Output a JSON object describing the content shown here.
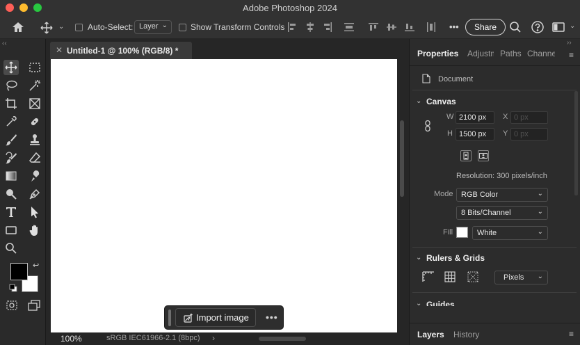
{
  "window": {
    "title": "Adobe Photoshop 2024"
  },
  "options_bar": {
    "auto_select_label": "Auto-Select:",
    "auto_select_value": "Layer",
    "show_transform_label": "Show Transform Controls",
    "more_label": "•••",
    "share_label": "Share"
  },
  "document": {
    "tab_title": "Untitled-1 @ 100% (RGB/8) *",
    "zoom": "100%",
    "color_profile": "sRGB IEC61966-2.1 (8bpc)",
    "status_chevron": "›"
  },
  "contextual_bar": {
    "import_label": "Import image",
    "more_label": "•••"
  },
  "panel": {
    "tabs": [
      "Properties",
      "Adjustm",
      "Paths",
      "Channe"
    ],
    "document_label": "Document",
    "canvas": {
      "title": "Canvas",
      "w_label": "W",
      "w_value": "2100 px",
      "h_label": "H",
      "h_value": "1500 px",
      "x_label": "X",
      "x_value": "0 px",
      "y_label": "Y",
      "y_value": "0 px",
      "resolution": "Resolution: 300 pixels/inch",
      "mode_label": "Mode",
      "mode_value": "RGB Color",
      "depth_value": "8 Bits/Channel",
      "fill_label": "Fill",
      "fill_value": "White"
    },
    "rulers": {
      "title": "Rulers & Grids",
      "units_value": "Pixels"
    },
    "guides_title": "Guides",
    "bottom_tabs": [
      "Layers",
      "History"
    ]
  },
  "colors": {
    "foreground": "#000000",
    "background": "#ffffff",
    "canvas": "#ffffff"
  }
}
